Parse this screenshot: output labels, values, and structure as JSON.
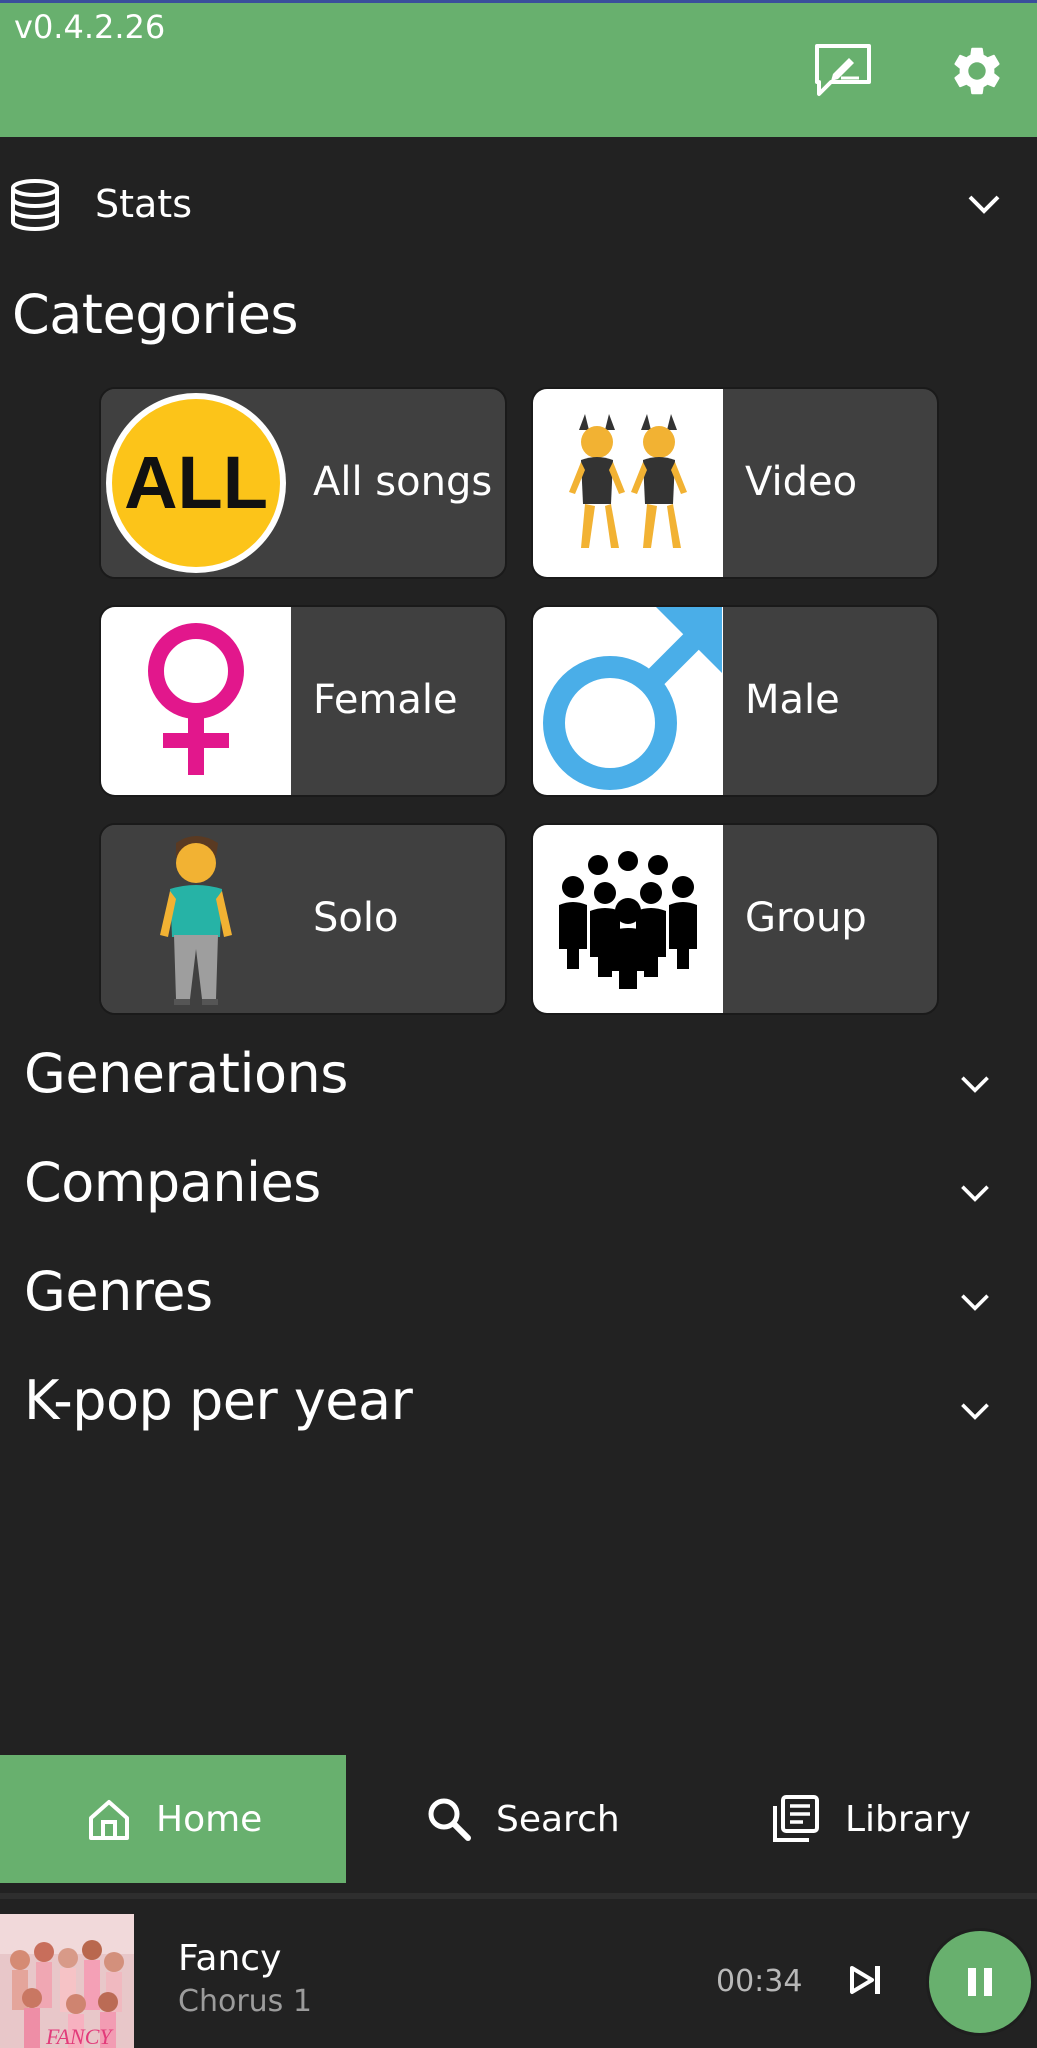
{
  "app": {
    "version": "v0.4.2.26",
    "accent_color": "#68b06e",
    "background_color": "#222222"
  },
  "header": {
    "feedback_icon": "feedback-icon",
    "settings_icon": "gear-icon"
  },
  "stats": {
    "label": "Stats",
    "icon": "database-icon"
  },
  "categories": {
    "title": "Categories",
    "items": [
      {
        "label": "All songs",
        "icon": "all-badge-icon",
        "badge_text": "ALL"
      },
      {
        "label": "Video",
        "icon": "dancers-icon"
      },
      {
        "label": "Female",
        "icon": "female-sign-icon"
      },
      {
        "label": "Male",
        "icon": "male-sign-icon"
      },
      {
        "label": "Solo",
        "icon": "person-icon"
      },
      {
        "label": "Group",
        "icon": "group-icon"
      }
    ]
  },
  "sections": [
    {
      "label": "Generations"
    },
    {
      "label": "Companies"
    },
    {
      "label": "Genres"
    },
    {
      "label": "K-pop per year"
    }
  ],
  "bottom_nav": {
    "items": [
      {
        "label": "Home",
        "icon": "home-icon",
        "active": true
      },
      {
        "label": "Search",
        "icon": "search-icon",
        "active": false
      },
      {
        "label": "Library",
        "icon": "library-icon",
        "active": false
      }
    ]
  },
  "player": {
    "title": "Fancy",
    "subtitle": "Chorus 1",
    "time": "00:34",
    "cover_text": "FANCY"
  }
}
